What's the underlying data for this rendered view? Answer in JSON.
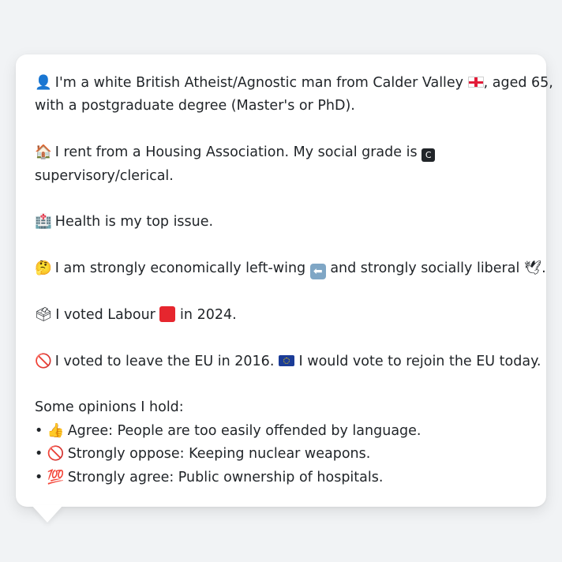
{
  "identity": {
    "icon": "👤",
    "text_a": "I'm a white British Atheist/Agnostic man from Calder Valley",
    "flag": "england-flag",
    "text_b": ", aged 65,",
    "text_c": "with a postgraduate degree (Master's or PhD)."
  },
  "housing": {
    "icon": "🏠",
    "text_a": "I rent from a Housing Association. My social grade is",
    "grade_badge": "C",
    "text_b": "supervisory/clerical."
  },
  "health": {
    "icon": "🏥",
    "text": "Health is my top issue."
  },
  "politics": {
    "icon": "🤔",
    "text_a": "I am strongly economically left-wing",
    "left_icon": "⬅",
    "text_b": "and strongly socially liberal",
    "dove_icon": "🕊",
    "text_c": "."
  },
  "vote": {
    "icon": "🗳",
    "text_a": "I voted Labour",
    "party_color": "#e6262e",
    "text_b": "in 2024."
  },
  "eu": {
    "icon": "🚫",
    "text_a": "I voted to leave the EU in 2016.",
    "flag": "eu-flag",
    "text_b": "I would vote to rejoin the EU today."
  },
  "opinions": {
    "heading": "Some opinions I hold:",
    "bullet": "•",
    "items": [
      {
        "icon": "👍",
        "text": "Agree: People are too easily offended by language."
      },
      {
        "icon": "🚫",
        "text": "Strongly oppose: Keeping nuclear weapons."
      },
      {
        "icon": "💯",
        "text": "Strongly agree: Public ownership of hospitals."
      }
    ]
  }
}
